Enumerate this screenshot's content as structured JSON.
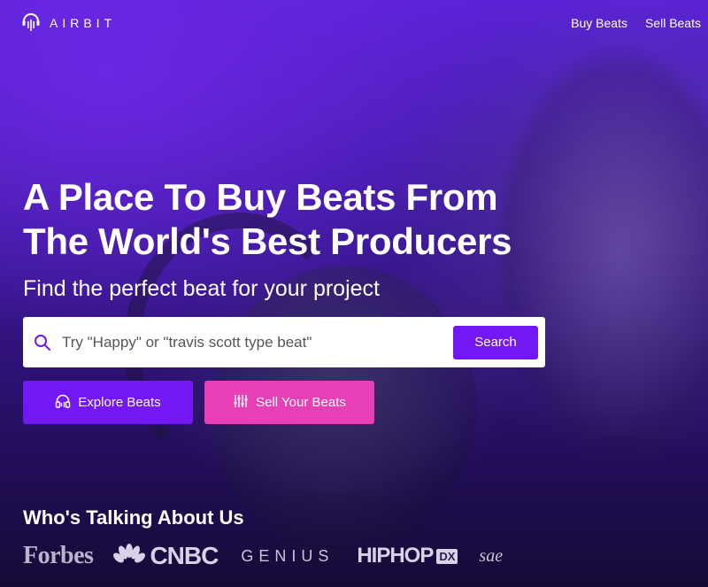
{
  "nav": {
    "logo_text": "AIRBIT",
    "links": [
      "Buy Beats",
      "Sell Beats"
    ]
  },
  "hero": {
    "headline_line1": "A Place To Buy Beats From",
    "headline_line2": "The World's Best Producers",
    "subhead": "Find the perfect beat for your project"
  },
  "search": {
    "placeholder": "Try \"Happy\" or \"travis scott type beat\"",
    "button_label": "Search"
  },
  "cta": {
    "explore_label": "Explore Beats",
    "sell_label": "Sell Your Beats"
  },
  "press": {
    "title": "Who's Talking About Us",
    "forbes": "Forbes",
    "cnbc": "CNBC",
    "genius": "GENIUS",
    "hiphop": "HIPHOP",
    "dx": "DX",
    "sae": "sae"
  },
  "colors": {
    "primary": "#7417f5",
    "pink": "#e93fb6",
    "hero_top": "#5a22d6",
    "hero_bottom": "#150a35"
  },
  "icons": {
    "logo": "headphones-bars-icon",
    "search": "search-icon",
    "explore": "headphones-icon",
    "sell": "sliders-icon"
  }
}
